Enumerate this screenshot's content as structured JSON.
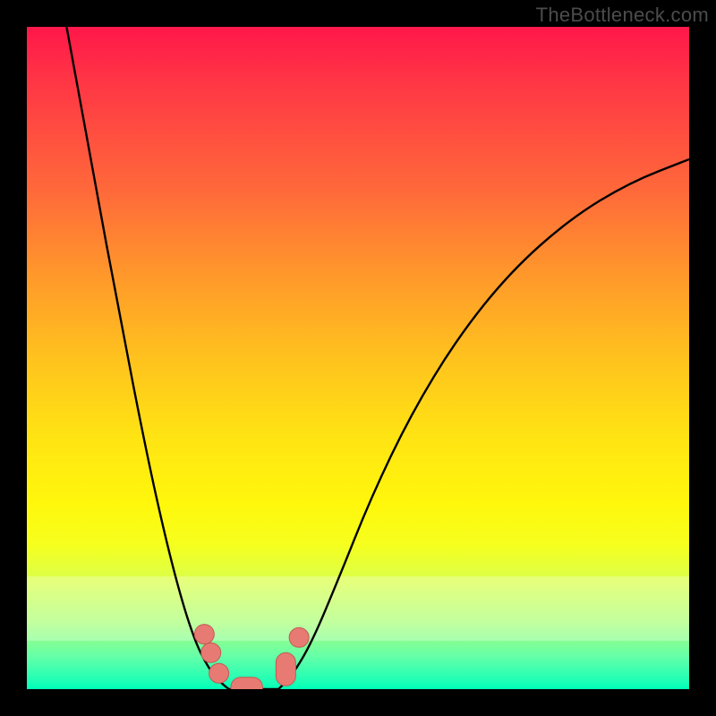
{
  "watermark": "TheBottleneck.com",
  "colors": {
    "frame": "#000000",
    "curve": "#000000",
    "marker_fill": "#e77b73",
    "marker_stroke": "#c05a54",
    "gradient_stops": [
      "#ff174a",
      "#ff3545",
      "#ff6a3a",
      "#ff9a2a",
      "#ffc21e",
      "#ffe413",
      "#fff70c",
      "#f6ff1d",
      "#d9ff4d",
      "#aaff7a",
      "#66ffa8",
      "#19ffb6",
      "#00ffb8"
    ]
  },
  "chart_data": {
    "type": "line",
    "title": "",
    "xlabel": "",
    "ylabel": "",
    "xlim": [
      0,
      1
    ],
    "ylim": [
      0,
      1
    ],
    "note": "Axes are unlabeled in the source image; values below are normalized 0–1 estimates read from pixel positions inside the plot area.",
    "series": [
      {
        "name": "left-branch",
        "x": [
          0.06,
          0.1,
          0.14,
          0.18,
          0.21,
          0.235,
          0.255,
          0.27,
          0.283,
          0.295,
          0.305
        ],
        "y": [
          1.0,
          0.78,
          0.565,
          0.36,
          0.225,
          0.13,
          0.07,
          0.04,
          0.02,
          0.008,
          0.0
        ]
      },
      {
        "name": "valley-floor",
        "x": [
          0.305,
          0.32,
          0.34,
          0.36,
          0.38
        ],
        "y": [
          0.0,
          0.0,
          0.0,
          0.0,
          0.0
        ]
      },
      {
        "name": "right-branch",
        "x": [
          0.38,
          0.4,
          0.43,
          0.47,
          0.52,
          0.58,
          0.65,
          0.73,
          0.82,
          0.91,
          1.0
        ],
        "y": [
          0.0,
          0.02,
          0.07,
          0.165,
          0.29,
          0.415,
          0.53,
          0.63,
          0.71,
          0.765,
          0.8
        ]
      }
    ],
    "markers": [
      {
        "shape": "circle",
        "x": 0.268,
        "y": 0.083
      },
      {
        "shape": "circle",
        "x": 0.278,
        "y": 0.055
      },
      {
        "shape": "circle",
        "x": 0.29,
        "y": 0.024
      },
      {
        "shape": "hcapsule",
        "x": 0.332,
        "y": 0.003,
        "w": 0.048
      },
      {
        "shape": "vcapsule",
        "x": 0.391,
        "y": 0.03,
        "h": 0.05
      },
      {
        "shape": "circle",
        "x": 0.411,
        "y": 0.078
      }
    ],
    "pale_band": {
      "y0": 0.073,
      "y1": 0.17
    }
  }
}
